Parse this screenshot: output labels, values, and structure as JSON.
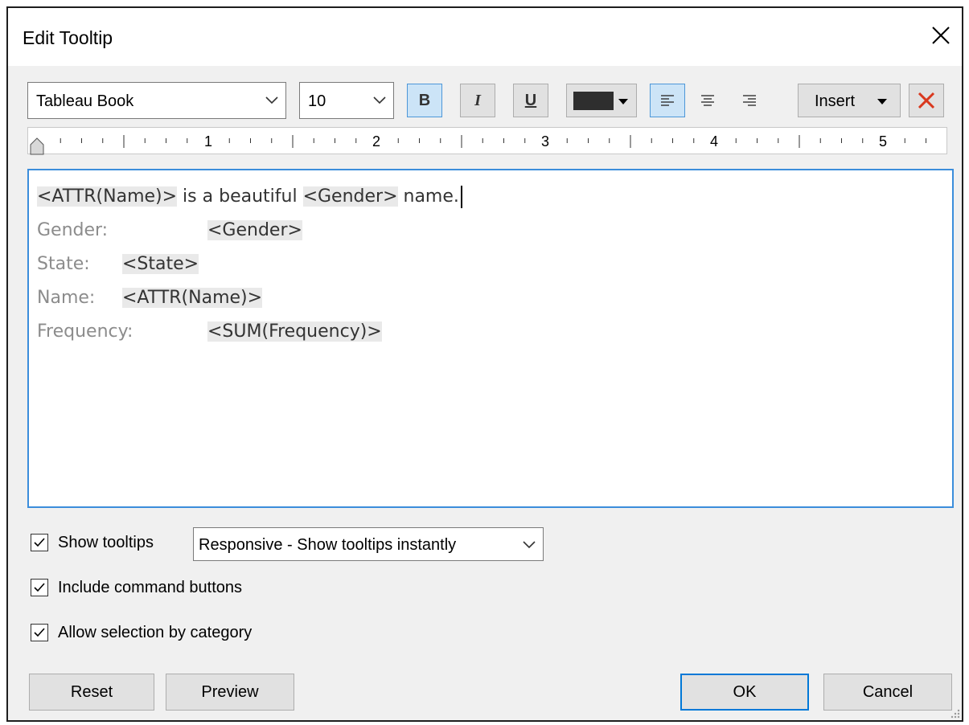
{
  "dialog": {
    "title": "Edit Tooltip"
  },
  "toolbar": {
    "font_family": "Tableau Book",
    "font_size": "10",
    "bold_label": "B",
    "italic_label": "I",
    "underline_label": "U",
    "text_color": "#2e2e2e",
    "insert_label": "Insert",
    "bold_active": true,
    "align_left_active": true
  },
  "ruler": {
    "marks": [
      "1",
      "2",
      "3",
      "4",
      "5"
    ]
  },
  "editor": {
    "line1": {
      "field_a": "<ATTR(Name)>",
      "text_a": " is a beautiful ",
      "field_b": "<Gender>",
      "text_b": " name."
    },
    "line2": {
      "label": "Gender:",
      "field": "<Gender>"
    },
    "line3": {
      "label": "State:",
      "field": "<State>"
    },
    "line4": {
      "label": "Name:",
      "field": "<ATTR(Name)>"
    },
    "line5": {
      "label": "Frequency:",
      "field": "<SUM(Frequency)>"
    }
  },
  "options": {
    "show_tooltips": {
      "label": "Show tooltips",
      "checked": true
    },
    "tooltip_mode": "Responsive - Show tooltips instantly",
    "include_command_buttons": {
      "label": "Include command buttons",
      "checked": true
    },
    "allow_selection_by_category": {
      "label": "Allow selection by category",
      "checked": true
    }
  },
  "buttons": {
    "reset": "Reset",
    "preview": "Preview",
    "ok": "OK",
    "cancel": "Cancel"
  },
  "colors": {
    "accent": "#0078d7",
    "field_bg": "#e9e9e9",
    "label_grey": "#8c8c8c"
  }
}
